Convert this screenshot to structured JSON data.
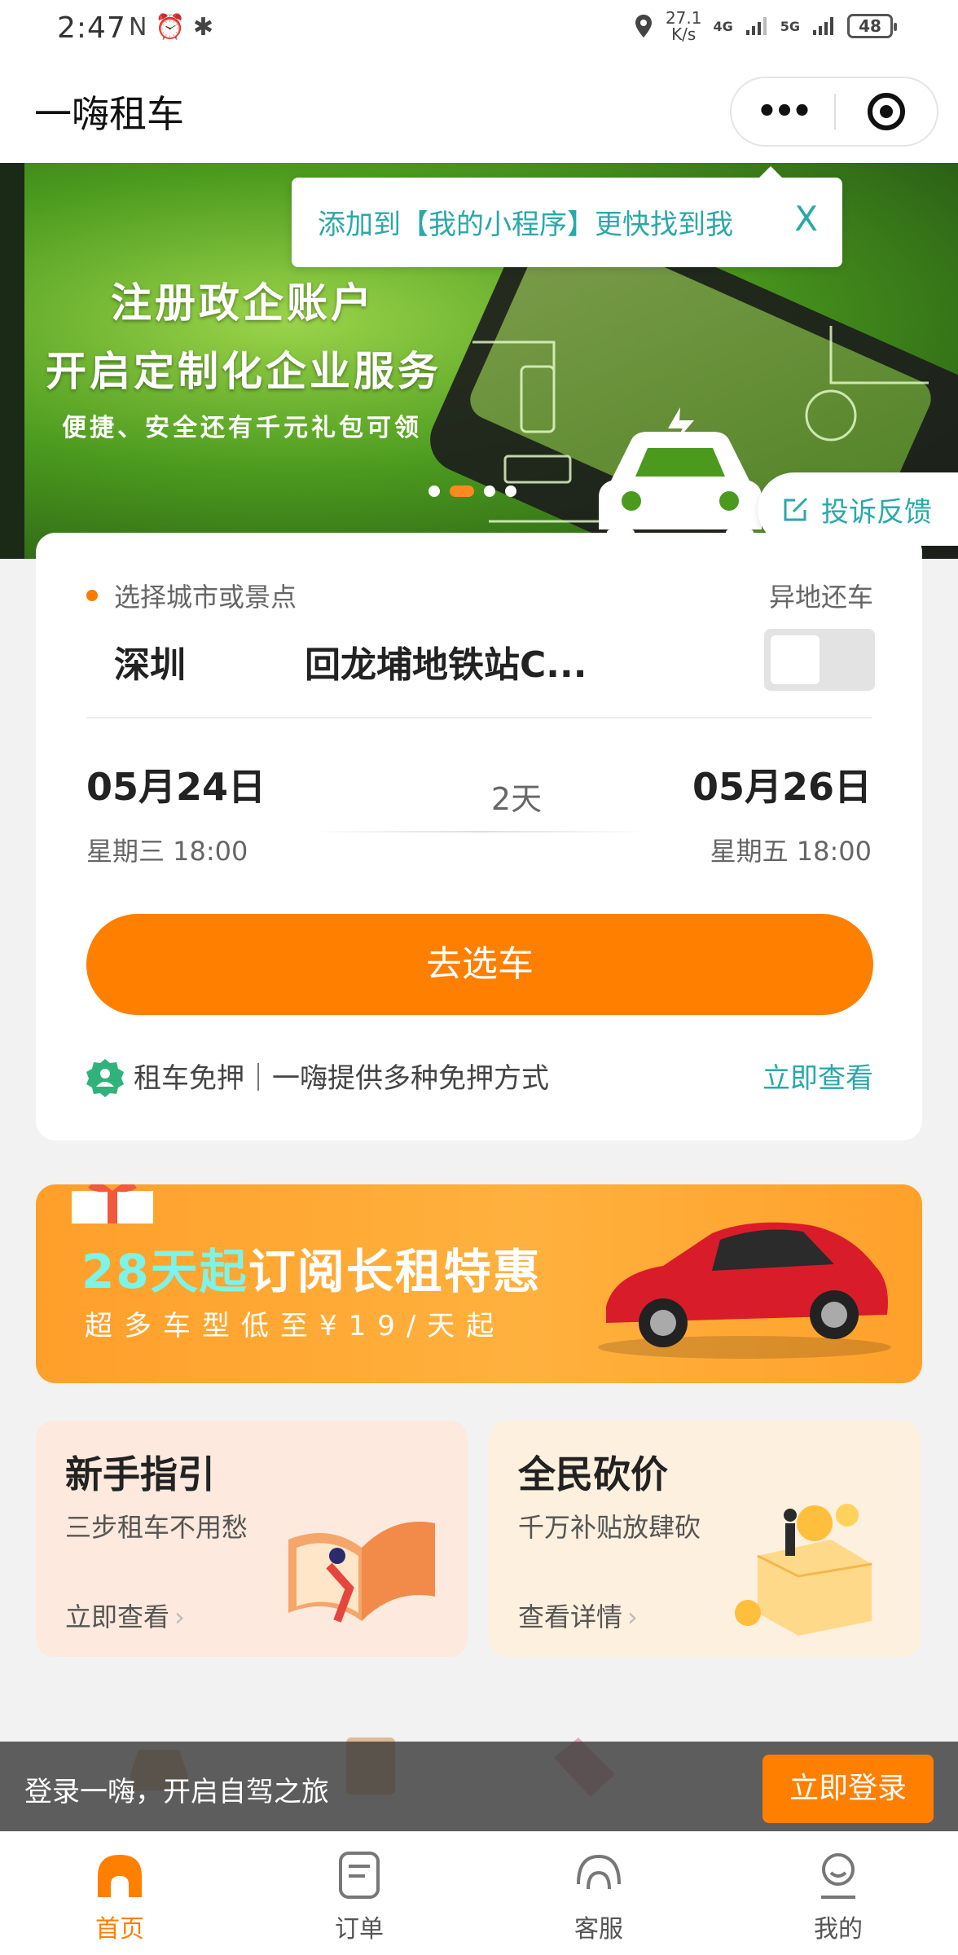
{
  "status_bar": {
    "time": "2:47",
    "left_icons": "N ⏰ ✱",
    "speed_value": "27.1",
    "speed_unit": "K/s",
    "network_1": "4G",
    "network_2": "5G",
    "battery": "48"
  },
  "header": {
    "title": "一嗨租车",
    "more_label": "•••"
  },
  "banner": {
    "line1": "注册政企账户",
    "line2": "开启定制化企业服务",
    "line3": "便捷、安全还有千元礼包可领",
    "slide_count": 4,
    "active_slide": 2
  },
  "tooltip": {
    "text": "添加到【我的小程序】更快找到我",
    "close": "X"
  },
  "feedback": {
    "label": "投诉反馈"
  },
  "booking": {
    "location_hint": "选择城市或景点",
    "different_return_label": "异地还车",
    "city": "深圳",
    "station": "回龙埔地铁站C...",
    "different_return_enabled": false,
    "pickup_date": "05月24日",
    "pickup_time": "星期三 18:00",
    "duration": "2天",
    "return_date": "05月26日",
    "return_time": "星期五 18:00",
    "cta": "去选车",
    "deposit_text": "租车免押｜一嗨提供多种免押方式",
    "deposit_link": "立即查看"
  },
  "promo": {
    "highlight": "28天起",
    "title_rest": "订阅长租特惠",
    "subtitle": "超多车型低至¥19/天起"
  },
  "cards": [
    {
      "title": "新手指引",
      "subtitle": "三步租车不用愁",
      "link": "立即查看"
    },
    {
      "title": "全民砍价",
      "subtitle": "千万补贴放肆砍",
      "link": "查看详情"
    }
  ],
  "login_bar": {
    "text": "登录一嗨，开启自驾之旅",
    "button": "立即登录"
  },
  "tabs": [
    {
      "label": "首页",
      "icon": "home-icon",
      "active": true
    },
    {
      "label": "订单",
      "icon": "order-icon",
      "active": false
    },
    {
      "label": "客服",
      "icon": "headset-icon",
      "active": false
    },
    {
      "label": "我的",
      "icon": "profile-icon",
      "active": false
    }
  ],
  "colors": {
    "brand_orange": "#ff7f00",
    "accent_teal": "#2aa8a8"
  }
}
